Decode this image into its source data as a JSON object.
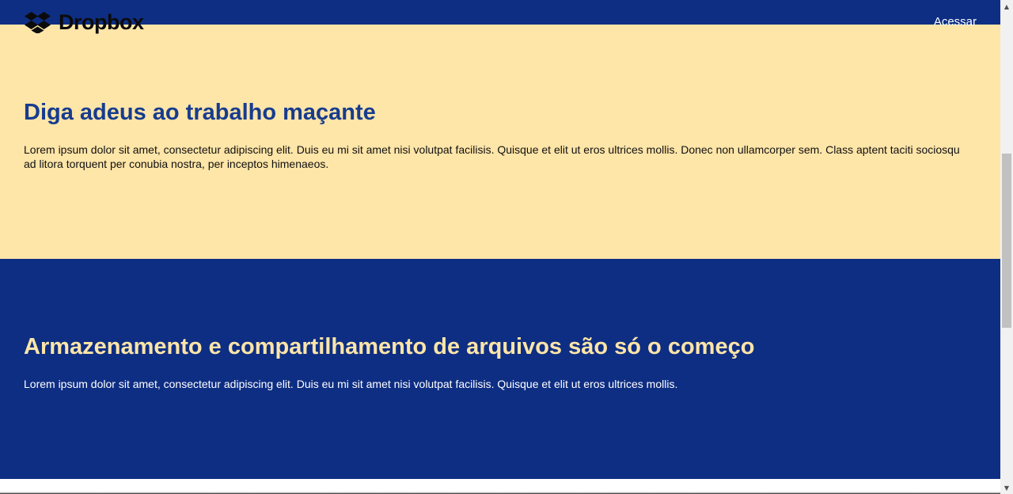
{
  "header": {
    "brand": "Dropbox",
    "login_label": "Acessar"
  },
  "hero": {
    "title": "Diga adeus ao trabalho maçante",
    "body": "Lorem ipsum dolor sit amet, consectetur adipiscing elit. Duis eu mi sit amet nisi volutpat facilisis. Quisque et elit ut eros ultrices mollis. Donec non ullamcorper sem. Class aptent taciti sociosqu ad litora torquent per conubia nostra, per inceptos himenaeos."
  },
  "storage": {
    "title": "Armazenamento e compartilhamento de arquivos são só o começo",
    "body": "Lorem ipsum dolor sit amet, consectetur adipiscing elit. Duis eu mi sit amet nisi volutpat facilisis. Quisque et elit ut eros ultrices mollis."
  },
  "icons": {
    "logo": "dropbox-logo-icon",
    "scroll_up": "chevron-up-icon",
    "scroll_down": "chevron-down-icon"
  },
  "colors": {
    "navy": "#0e2e83",
    "cream": "#fee5a8",
    "heading_blue": "#163c8e"
  }
}
